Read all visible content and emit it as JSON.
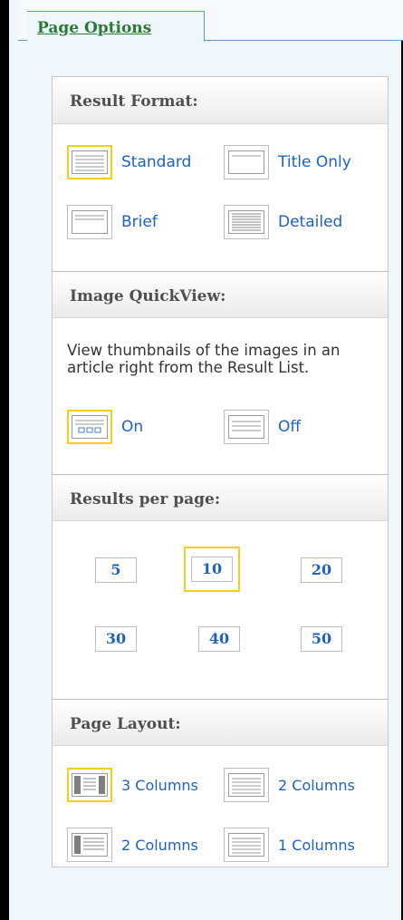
{
  "tab": {
    "label": "Page Options"
  },
  "result_format": {
    "heading": "Result Format:",
    "options": [
      {
        "label": "Standard",
        "selected": true,
        "icon": "standard-format-icon"
      },
      {
        "label": "Title Only",
        "selected": false,
        "icon": "title-only-format-icon"
      },
      {
        "label": "Brief",
        "selected": false,
        "icon": "brief-format-icon"
      },
      {
        "label": "Detailed",
        "selected": false,
        "icon": "detailed-format-icon"
      }
    ]
  },
  "image_quickview": {
    "heading": "Image QuickView:",
    "description": "View thumbnails of the images in an article right from the Result List.",
    "options": [
      {
        "label": "On",
        "selected": true,
        "icon": "quickview-on-icon"
      },
      {
        "label": "Off",
        "selected": false,
        "icon": "quickview-off-icon"
      }
    ]
  },
  "results_per_page": {
    "heading": "Results per page:",
    "options": [
      "5",
      "10",
      "20",
      "30",
      "40",
      "50"
    ],
    "selected": "10"
  },
  "page_layout": {
    "heading": "Page Layout:",
    "options": [
      {
        "label": "3 Columns",
        "selected": true,
        "icon": "three-columns-layout-icon"
      },
      {
        "label": "2 Columns",
        "selected": false,
        "icon": "two-columns-right-layout-icon"
      },
      {
        "label": "2 Columns",
        "selected": false,
        "icon": "two-columns-left-layout-icon"
      },
      {
        "label": "1 Columns",
        "selected": false,
        "icon": "one-column-layout-icon"
      }
    ]
  },
  "colors": {
    "link": "#1b62c4",
    "tab_text": "#2a7a34",
    "selection_border": "#f5ce1a",
    "panel_border": "#c9c9c9",
    "tab_border": "#5d9bd0"
  }
}
